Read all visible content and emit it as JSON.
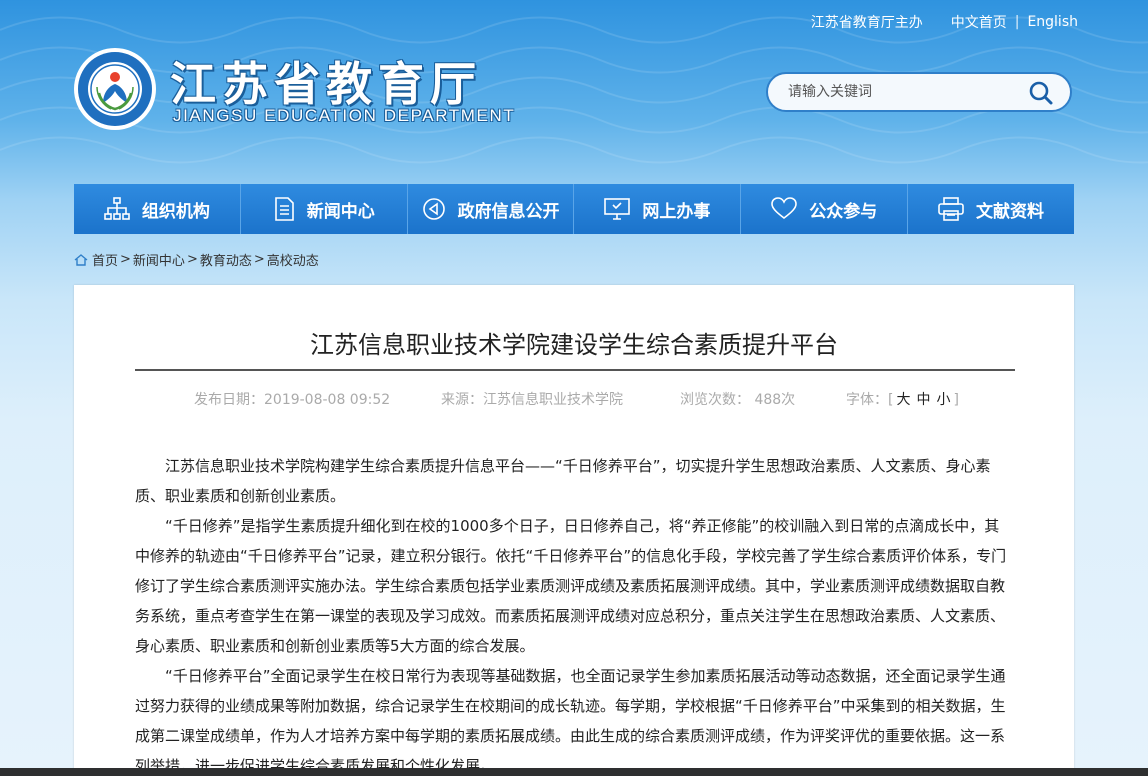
{
  "header": {
    "host_link": "江苏省教育厅主办",
    "lang_cn": "中文首页",
    "lang_sep": "|",
    "lang_en": "English",
    "brand_cn": "江苏省教育厅",
    "brand_en": "JIANGSU EDUCATION DEPARTMENT"
  },
  "search": {
    "placeholder": "请输入关键词"
  },
  "nav": [
    {
      "label": "组织机构",
      "icon": "org-chart-icon"
    },
    {
      "label": "新闻中心",
      "icon": "document-icon"
    },
    {
      "label": "政府信息公开",
      "icon": "megaphone-icon"
    },
    {
      "label": "网上办事",
      "icon": "monitor-icon"
    },
    {
      "label": "公众参与",
      "icon": "heart-icon"
    },
    {
      "label": "文献资料",
      "icon": "printer-icon"
    }
  ],
  "breadcrumb": {
    "items": [
      "首页",
      "新闻中心",
      "教育动态",
      "高校动态"
    ],
    "sep": ">"
  },
  "article": {
    "title": "江苏信息职业技术学院建设学生综合素质提升平台",
    "publish": "发布日期：2019-08-08 09:52",
    "source": "来源：江苏信息职业技术学院",
    "views": "浏览次数： 488次",
    "font_label": "字体：[",
    "font_large": "大",
    "font_medium": "中",
    "font_small": "小",
    "font_end": "]",
    "paragraphs": [
      "江苏信息职业技术学院构建学生综合素质提升信息平台——“千日修养平台”，切实提升学生思想政治素质、人文素质、身心素质、职业素质和创新创业素质。",
      "“千日修养”是指学生素质提升细化到在校的1000多个日子，日日修养自己，将“养正修能”的校训融入到日常的点滴成长中，其中修养的轨迹由“千日修养平台”记录，建立积分银行。依托“千日修养平台”的信息化手段，学校完善了学生综合素质评价体系，专门修订了学生综合素质测评实施办法。学生综合素质包括学业素质测评成绩及素质拓展测评成绩。其中，学业素质测评成绩数据取自教务系统，重点考查学生在第一课堂的表现及学习成效。而素质拓展测评成绩对应总积分，重点关注学生在思想政治素质、人文素质、身心素质、职业素质和创新创业素质等5大方面的综合发展。",
      "“千日修养平台”全面记录学生在校日常行为表现等基础数据，也全面记录学生参加素质拓展活动等动态数据，还全面记录学生通过努力获得的业绩成果等附加数据，综合记录学生在校期间的成长轨迹。每学期，学校根据“千日修养平台”中采集到的相关数据，生成第二课堂成绩单，作为人才培养方案中每学期的素质拓展成绩。由此生成的综合素质测评成绩，作为评奖评优的重要依据。这一系列举措，进一步促进学生综合素质发展和个性化发展。"
    ]
  },
  "colors": {
    "nav_bg": "#1f7bd1",
    "brand_shadow": "#1a5e9a",
    "search_border": "#2f7fc9"
  }
}
